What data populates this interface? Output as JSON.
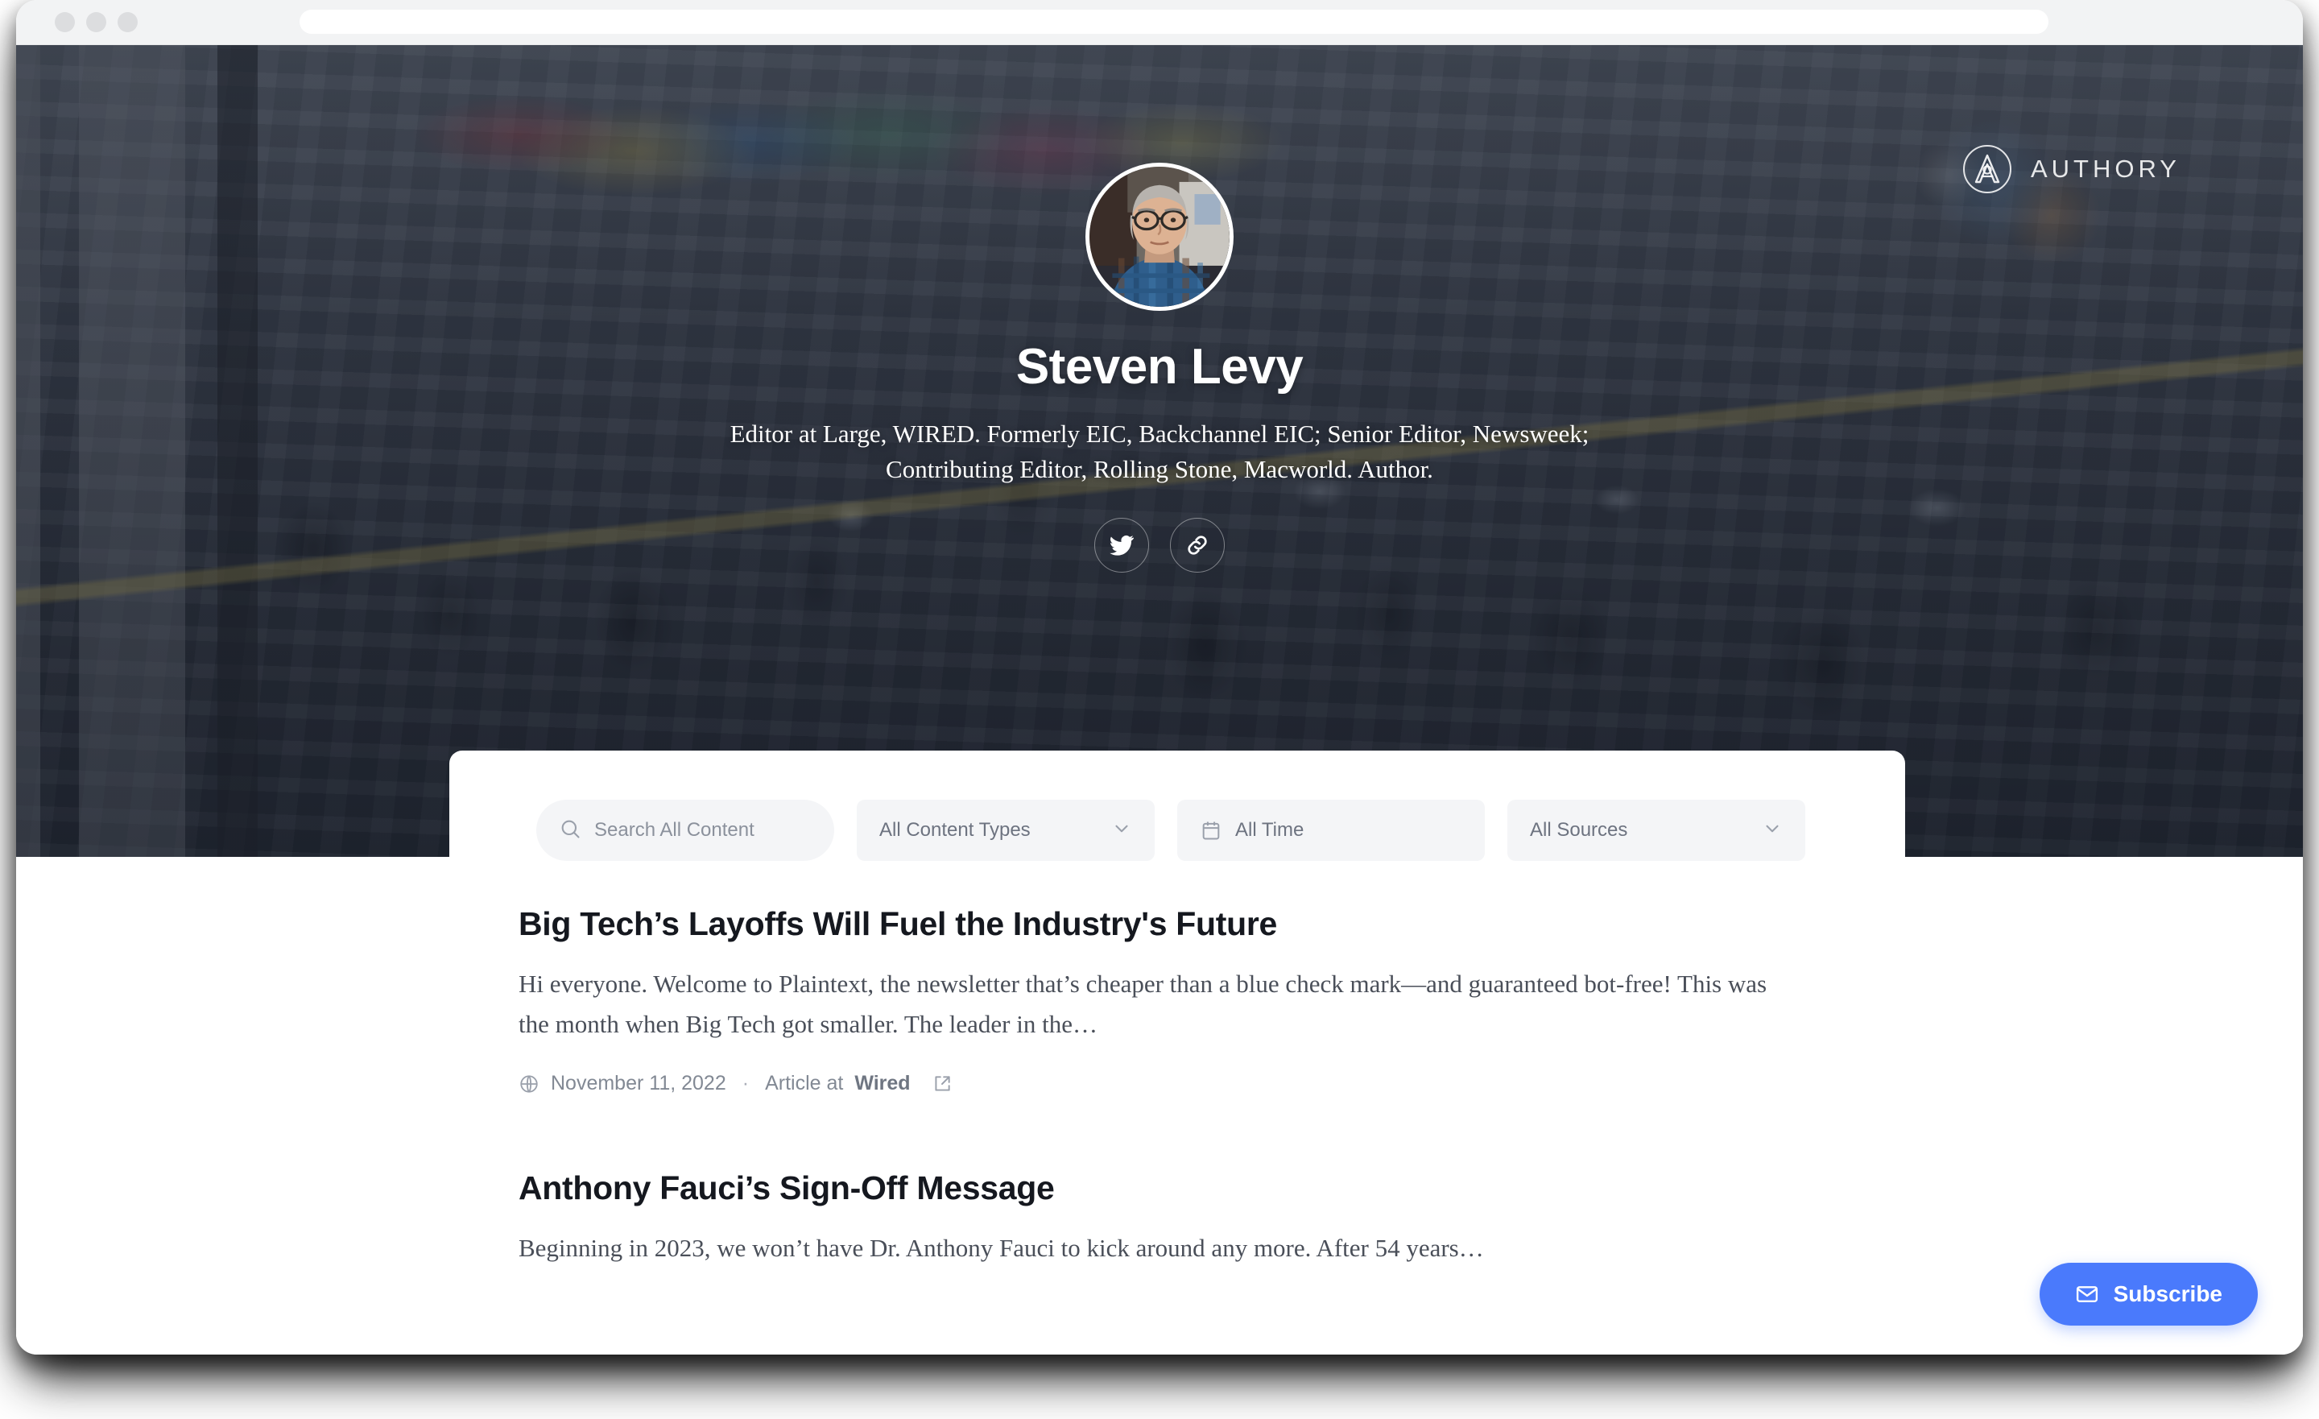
{
  "browser": {
    "url_value": "",
    "url_placeholder": "",
    "traffic_lights": [
      "close",
      "minimize",
      "maximize"
    ]
  },
  "brand": {
    "logo_icon": "authory-compass-icon",
    "name": "AUTHORY"
  },
  "profile": {
    "avatar_alt": "Steven Levy portrait",
    "name": "Steven Levy",
    "bio_line1": "Editor at Large, WIRED. Formerly EIC, Backchannel EIC; Senior Editor, Newsweek;",
    "bio_line2": "Contributing Editor, Rolling Stone, Macworld. Author.",
    "socials": [
      {
        "icon": "twitter-icon",
        "label": "Twitter"
      },
      {
        "icon": "link-icon",
        "label": "Website"
      }
    ]
  },
  "filters": {
    "search": {
      "icon": "search-icon",
      "value": "",
      "placeholder": "Search All Content"
    },
    "content_type": {
      "label": "All Content Types",
      "icon": "chevron-down-icon"
    },
    "time": {
      "icon": "calendar-icon",
      "label": "All Time"
    },
    "sources": {
      "label": "All Sources",
      "icon": "chevron-down-icon"
    }
  },
  "feed": {
    "articles": [
      {
        "title": "Big Tech’s Layoffs Will Fuel the Industry's Future",
        "excerpt": "Hi everyone. Welcome to Plaintext, the newsletter that’s cheaper than a blue check mark—and guaranteed bot-free! This was the month when Big Tech got smaller. The leader in the…",
        "meta": {
          "type_icon": "globe-icon",
          "date": "November 11, 2022",
          "separator": "·",
          "source_prefix": "Article at",
          "source_name": "Wired",
          "external_icon": "external-link-icon"
        }
      },
      {
        "title": "Anthony Fauci’s Sign-Off Message",
        "excerpt": "Beginning in 2023, we won’t have Dr. Anthony Fauci to kick around any more. After 54 years…",
        "meta": {
          "type_icon": "globe-icon",
          "date": "",
          "separator": "·",
          "source_prefix": "",
          "source_name": "",
          "external_icon": "external-link-icon"
        }
      }
    ]
  },
  "subscribe": {
    "icon": "envelope-icon",
    "label": "Subscribe",
    "accent_color": "#4a7afc"
  },
  "colors": {
    "accent": "#4a7afc",
    "chrome_bg": "#f2f3f4",
    "field_bg": "#f4f5f7",
    "title_text": "#15181f",
    "muted_text": "#828994"
  }
}
